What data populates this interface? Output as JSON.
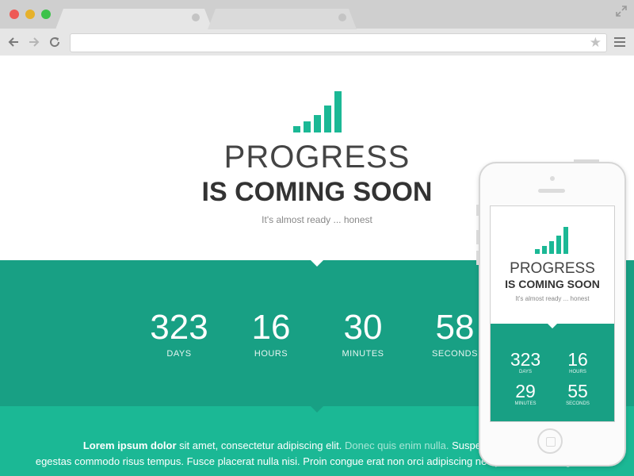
{
  "browser": {
    "window_buttons": {
      "close_color": "#ee5a55",
      "minimize_color": "#e6b12b",
      "maximize_color": "#3dc24b"
    },
    "url": ""
  },
  "hero": {
    "title_line1": "PROGRESS",
    "title_line2": "IS COMING SOON",
    "tagline": "It's almost ready ... honest",
    "logo_color": "#1bb895"
  },
  "countdown": [
    {
      "value": "323",
      "label": "DAYS"
    },
    {
      "value": "16",
      "label": "HOURS"
    },
    {
      "value": "30",
      "label": "MINUTES"
    },
    {
      "value": "58",
      "label": "SECONDS"
    }
  ],
  "body_text": {
    "lead": "Lorem ipsum dolor",
    "part1": " sit amet, consectetur adipiscing elit. ",
    "highlight": "Donec quis enim nulla.",
    "part2": " Suspendisse posuere",
    "line2": "egestas commodo risus tempus. Fusce placerat nulla nisi. Proin congue erat non orci adipiscing nec porttitor lacus egestas."
  },
  "mobile": {
    "title_line1": "PROGRESS",
    "title_line2": "IS COMING SOON",
    "tagline": "It's almost ready ... honest",
    "countdown": [
      {
        "value": "323",
        "label": "DAYS"
      },
      {
        "value": "16",
        "label": "HOURS"
      },
      {
        "value": "29",
        "label": "MINUTES"
      },
      {
        "value": "55",
        "label": "SECONDS"
      }
    ]
  },
  "colors": {
    "accent_dark": "#18a084",
    "accent_light": "#1bb895"
  }
}
